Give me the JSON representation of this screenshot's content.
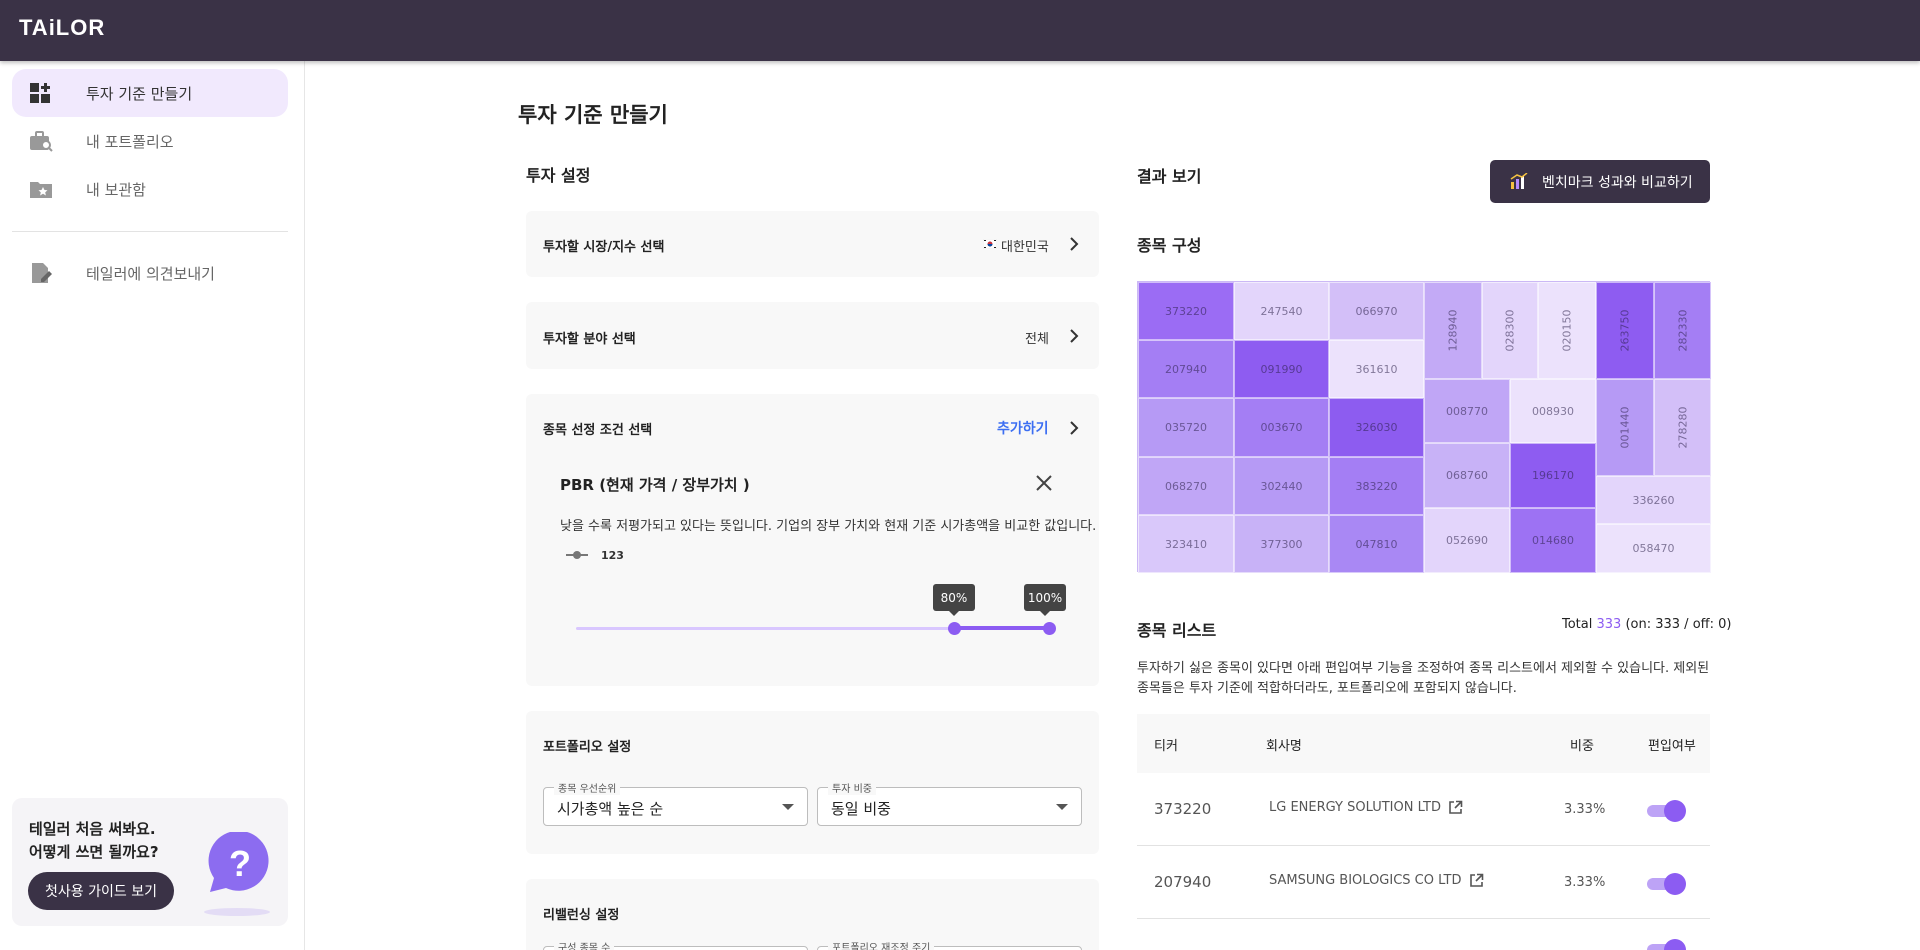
{
  "app": {
    "logo": "TAiLOR"
  },
  "sidebar": {
    "items": [
      {
        "label": "투자 기준 만들기",
        "active": true,
        "icon": "dashboard-add-icon"
      },
      {
        "label": "내 포트폴리오",
        "active": false,
        "icon": "briefcase-search-icon"
      },
      {
        "label": "내 보관함",
        "active": false,
        "icon": "folder-star-icon"
      },
      {
        "label": "테일러에 의견보내기",
        "active": false,
        "icon": "edit-note-icon"
      }
    ],
    "guide": {
      "line1": "테일러 처음 써봐요.",
      "line2": "어떻게 쓰면 될까요?",
      "button": "첫사용 가이드 보기",
      "icon": "question-bubble-icon"
    }
  },
  "page": {
    "title": "투자 기준 만들기"
  },
  "settings": {
    "title": "투자 설정",
    "market": {
      "label": "투자할 시장/지수 선택",
      "value": "대한민국",
      "flag": "korea-flag-icon"
    },
    "sector": {
      "label": "투자할 분야 선택",
      "value": "전체"
    },
    "condition": {
      "label": "종목 선정 조건 선택",
      "add_label": "추가하기",
      "item": {
        "title": "PBR (현재 가격 / 장부가치 )",
        "description": "낮을 수록 저평가되고 있다는 뜻입니다. 기업의 장부 가치와 현재 기준 시가총액을 비교한 값입니다.",
        "legend": "123",
        "range_low": "80%",
        "range_high": "100%",
        "range_low_value": 80,
        "range_high_value": 100
      }
    },
    "portfolio": {
      "label": "포트폴리오 설정",
      "priority_label": "종목 우선순위",
      "priority_value": "시가총액 높은 순",
      "weight_label": "투자 비중",
      "weight_value": "동일 비중"
    },
    "rebalance": {
      "label": "리밸런싱 설정",
      "count_label": "구성 종목 수",
      "cycle_label": "포트폴리오 재조정 주기"
    }
  },
  "results": {
    "title": "결과 보기",
    "benchmark_button": "벤치마크 성과와 비교하기",
    "composition_title": "종목 구성",
    "treemap": [
      {
        "code": "373220",
        "color": "#9b6cf4"
      },
      {
        "code": "247540",
        "color": "#e3d5fb"
      },
      {
        "code": "066970",
        "color": "#d3bff8"
      },
      {
        "code": "207940",
        "color": "#a47ef4"
      },
      {
        "code": "091990",
        "color": "#8e5cf1"
      },
      {
        "code": "361610",
        "color": "#ece2fc"
      },
      {
        "code": "035720",
        "color": "#b69af5"
      },
      {
        "code": "003670",
        "color": "#a47ef4"
      },
      {
        "code": "326030",
        "color": "#8d5cf0"
      },
      {
        "code": "068270",
        "color": "#c0a6f6"
      },
      {
        "code": "302440",
        "color": "#b69af5"
      },
      {
        "code": "383220",
        "color": "#a47ef4"
      },
      {
        "code": "323410",
        "color": "#d9c8fa"
      },
      {
        "code": "377300",
        "color": "#c8b2f7"
      },
      {
        "code": "047810",
        "color": "#a988f4"
      },
      {
        "code": "128940",
        "color": "#c3aaf6"
      },
      {
        "code": "028300",
        "color": "#e3d5fb"
      },
      {
        "code": "020150",
        "color": "#ece2fc"
      },
      {
        "code": "263750",
        "color": "#8e5cf1"
      },
      {
        "code": "282330",
        "color": "#a47ef4"
      },
      {
        "code": "008770",
        "color": "#c0a6f6"
      },
      {
        "code": "008930",
        "color": "#ece2fc"
      },
      {
        "code": "001440",
        "color": "#b69af5"
      },
      {
        "code": "278280",
        "color": "#d3bff8"
      },
      {
        "code": "068760",
        "color": "#c8b2f7"
      },
      {
        "code": "196170",
        "color": "#8e5cf1"
      },
      {
        "code": "336260",
        "color": "#e3d5fb"
      },
      {
        "code": "052690",
        "color": "#e3d5fb"
      },
      {
        "code": "014680",
        "color": "#9d72f3"
      },
      {
        "code": "058470",
        "color": "#ece2fc"
      }
    ],
    "list": {
      "title": "종목 리스트",
      "total_prefix": "Total ",
      "total": "333",
      "total_suffix": " (on: 333 / off: 0)",
      "description": "투자하기 싫은 종목이 있다면 아래 편입여부 기능을 조정하여 종목 리스트에서 제외할 수 있습니다. 제외된 종목들은 투자 기준에 적합하더라도, 포트폴리오에 포함되지 않습니다.",
      "columns": [
        "티커",
        "회사명",
        "비중",
        "편입여부"
      ],
      "rows": [
        {
          "ticker": "373220",
          "company": "LG ENERGY SOLUTION LTD",
          "weight": "3.33%",
          "included": true
        },
        {
          "ticker": "207940",
          "company": "SAMSUNG BIOLOGICS CO LTD",
          "weight": "3.33%",
          "included": true
        }
      ]
    }
  },
  "colors": {
    "accent": "#8c5cf2",
    "header": "#3a3246",
    "link": "#3d6ff2",
    "active_nav": "#f1e9fd"
  }
}
